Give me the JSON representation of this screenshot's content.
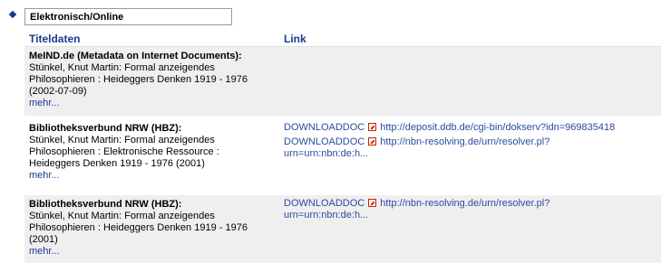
{
  "section": {
    "label": "Elektronisch/Online"
  },
  "headers": {
    "title": "Titeldaten",
    "link": "Link"
  },
  "rows": [
    {
      "source": "MeIND.de (Metadata on Internet Documents):",
      "desc": [
        "Stünkel, Knut Martin: Formal anzeigendes",
        "Philosophieren : Heideggers Denken 1919 - 1976",
        "(2002-07-09)"
      ],
      "more": "mehr...",
      "links": []
    },
    {
      "source": "Bibliotheksverbund NRW (HBZ):",
      "desc": [
        "Stünkel, Knut Martin: Formal anzeigendes",
        "Philosophieren : Elektronische Ressource :",
        "Heideggers Denken 1919 - 1976 (2001)"
      ],
      "more": "mehr...",
      "links": [
        {
          "label": "DOWNLOADDOC",
          "url": "http://deposit.ddb.de/cgi-bin/dokserv?idn=969835418",
          "url_cont": ""
        },
        {
          "label": "DOWNLOADDOC",
          "url": "http://nbn-resolving.de/urn/resolver.pl?",
          "url_cont": "urn=urn:nbn:de:h..."
        }
      ]
    },
    {
      "source": "Bibliotheksverbund NRW (HBZ):",
      "desc": [
        "Stünkel, Knut Martin: Formal anzeigendes",
        "Philosophieren : Heideggers Denken 1919 - 1976",
        "(2001)"
      ],
      "more": "mehr...",
      "links": [
        {
          "label": "DOWNLOADDOC",
          "url": "http://nbn-resolving.de/urn/resolver.pl?",
          "url_cont": "urn=urn:nbn:de:h..."
        }
      ]
    }
  ]
}
